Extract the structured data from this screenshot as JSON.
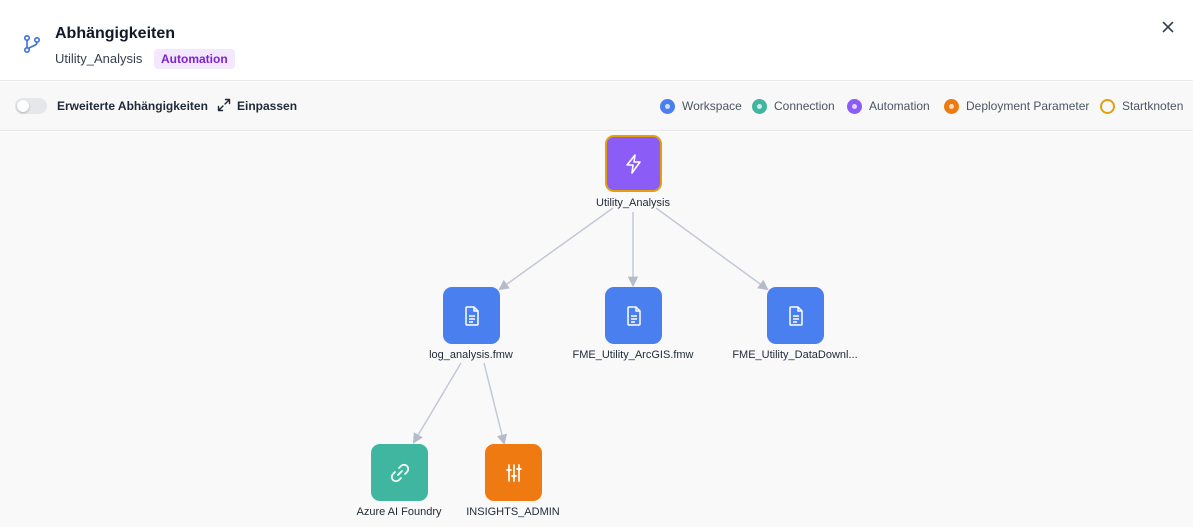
{
  "header": {
    "title": "Abhängigkeiten",
    "subtitle": "Utility_Analysis",
    "badge": "Automation"
  },
  "toolbar": {
    "toggle_label": "Erweiterte Abhängigkeiten",
    "fit_label": "Einpassen"
  },
  "legend": [
    {
      "label": "Workspace",
      "color": "#4a7ff0"
    },
    {
      "label": "Connection",
      "color": "#40b6a0"
    },
    {
      "label": "Automation",
      "color": "#8b5cf6"
    },
    {
      "label": "Deployment Parameter",
      "color": "#f07a12"
    },
    {
      "label": "Startknoten",
      "color": "#e3a008"
    }
  ],
  "nodes": [
    {
      "label": "Utility_Analysis",
      "type": "automation",
      "icon": "lightning-icon",
      "start": true
    },
    {
      "label": "log_analysis.fmw",
      "type": "workspace",
      "icon": "document-icon"
    },
    {
      "label": "FME_Utility_ArcGIS.fmw",
      "type": "workspace",
      "icon": "document-icon"
    },
    {
      "label": "FME_Utility_DataDownl...",
      "type": "workspace",
      "icon": "document-icon"
    },
    {
      "label": "Azure AI Foundry",
      "type": "connection",
      "icon": "link-icon"
    },
    {
      "label": "INSIGHTS_ADMIN",
      "type": "deployment-parameter",
      "icon": "sliders-icon"
    }
  ]
}
